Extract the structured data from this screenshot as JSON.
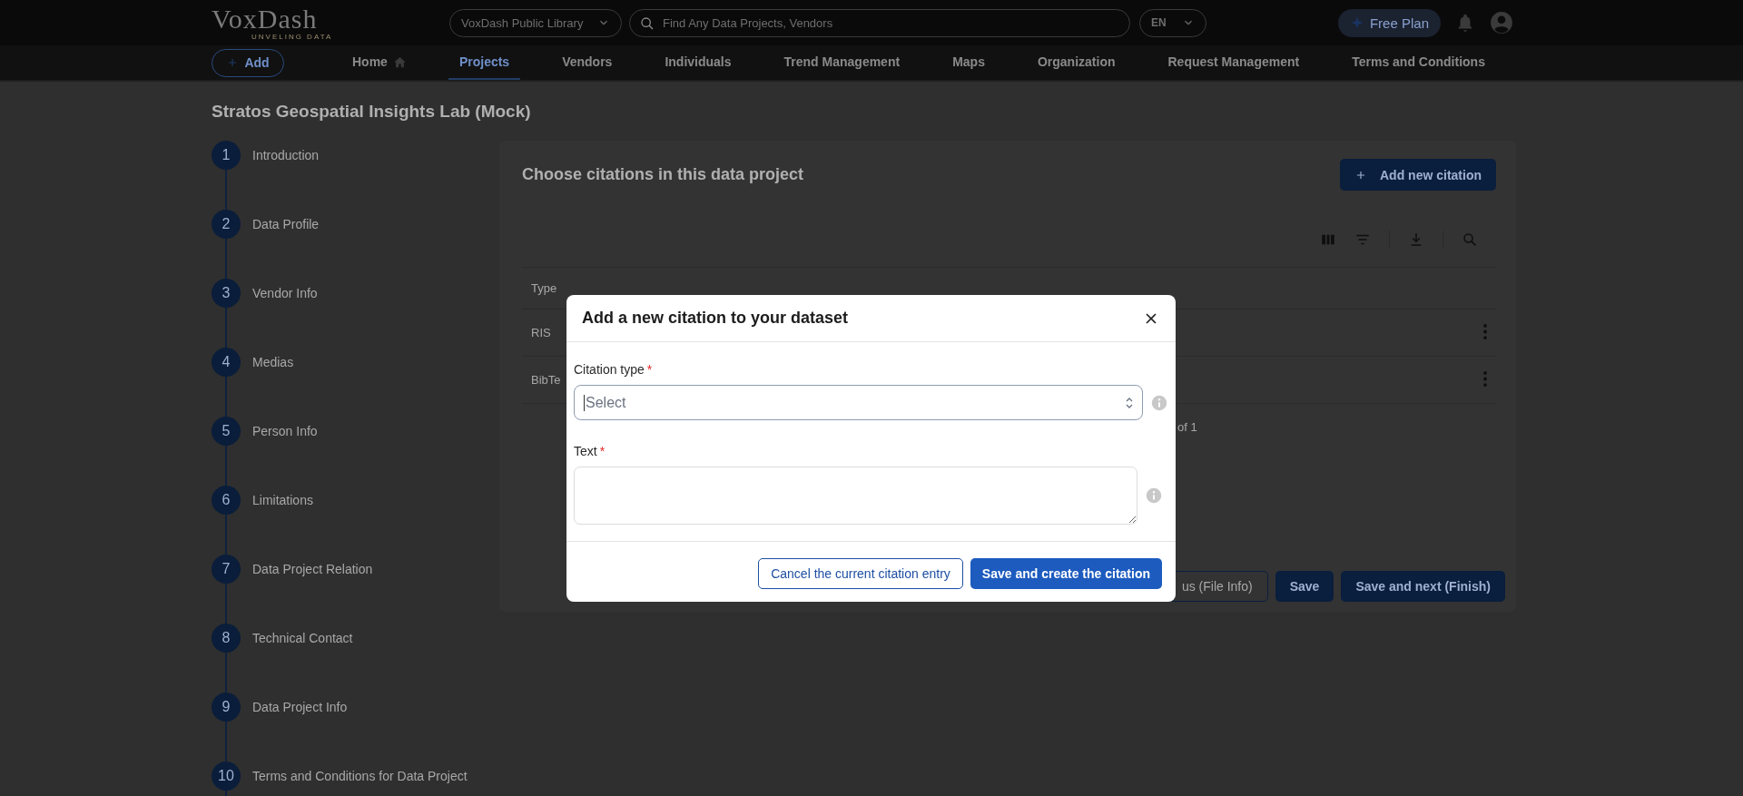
{
  "header": {
    "logo": "VoxDash",
    "logo_tagline": "UNVELING DATA",
    "library_select": "VoxDash Public Library",
    "search": {
      "placeholder": "Find Any Data Projects, Vendors"
    },
    "language": "EN",
    "plan_button": "Free Plan"
  },
  "nav": {
    "add_button": "Add",
    "items": [
      {
        "label": "Home",
        "selected": false,
        "kind": "home"
      },
      {
        "label": "Projects",
        "selected": true,
        "kind": "plain"
      },
      {
        "label": "Vendors",
        "selected": false,
        "kind": "plain"
      },
      {
        "label": "Individuals",
        "selected": false,
        "kind": "plain"
      },
      {
        "label": "Trend Management",
        "selected": false,
        "kind": "plain"
      },
      {
        "label": "Maps",
        "selected": false,
        "kind": "plain"
      },
      {
        "label": "Organization",
        "selected": false,
        "kind": "plain"
      },
      {
        "label": "Request Management",
        "selected": false,
        "kind": "plain"
      },
      {
        "label": "Terms and Conditions",
        "selected": false,
        "kind": "plain"
      }
    ]
  },
  "page_title": "Stratos Geospatial Insights Lab (Mock)",
  "steps": [
    {
      "number": "1",
      "label": "Introduction"
    },
    {
      "number": "2",
      "label": "Data Profile"
    },
    {
      "number": "3",
      "label": "Vendor Info"
    },
    {
      "number": "4",
      "label": "Medias"
    },
    {
      "number": "5",
      "label": "Person Info"
    },
    {
      "number": "6",
      "label": "Limitations"
    },
    {
      "number": "7",
      "label": "Data Project Relation"
    },
    {
      "number": "8",
      "label": "Technical Contact"
    },
    {
      "number": "9",
      "label": "Data Project Info"
    },
    {
      "number": "10",
      "label": "Terms and Conditions for Data Project"
    }
  ],
  "citations": {
    "title": "Choose citations in this data project",
    "add_button": "Add new citation",
    "columns": [
      "Type"
    ],
    "rows": [
      [
        "RIS"
      ],
      [
        "BibTe"
      ]
    ],
    "pagination": "of 1"
  },
  "footer_buttons": [
    {
      "label": "us (File Info)",
      "kind": "outline"
    },
    {
      "label": "Save",
      "kind": "filled"
    },
    {
      "label": "Save and next (Finish)",
      "kind": "filled"
    }
  ],
  "dialog": {
    "title": "Add a new citation to your dataset",
    "fields": [
      {
        "label": "Citation type",
        "required_mark": "*",
        "kind": "select",
        "placeholder": "Select"
      },
      {
        "label": "Text",
        "required_mark": "*",
        "kind": "textarea"
      }
    ],
    "buttons": [
      {
        "label": "Cancel the current citation entry",
        "kind": "outline"
      },
      {
        "label": "Save and create the citation",
        "kind": "filled"
      }
    ]
  }
}
